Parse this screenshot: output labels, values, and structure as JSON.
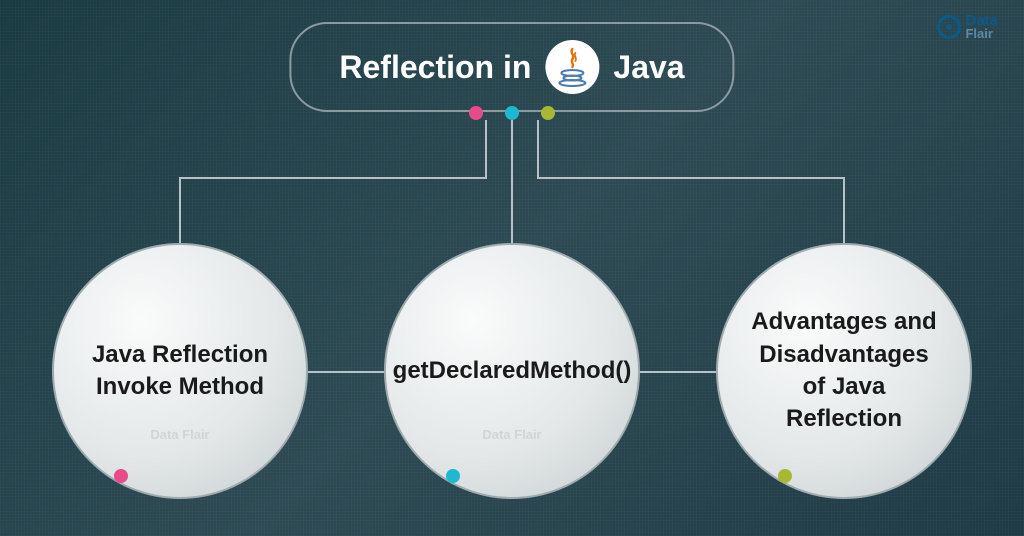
{
  "logo": {
    "main": "Data",
    "sub": "Flair"
  },
  "title": {
    "prefix": "Reflection in",
    "suffix": "Java"
  },
  "dots": [
    "pink",
    "cyan",
    "olive"
  ],
  "circles": [
    {
      "label": "Java Reflection Invoke Method",
      "watermark": "Data Flair"
    },
    {
      "label": "getDeclaredMethod()",
      "watermark": "Data Flair"
    },
    {
      "label": "Advantages and Disadvantages of Java Reflection",
      "watermark": ""
    }
  ]
}
